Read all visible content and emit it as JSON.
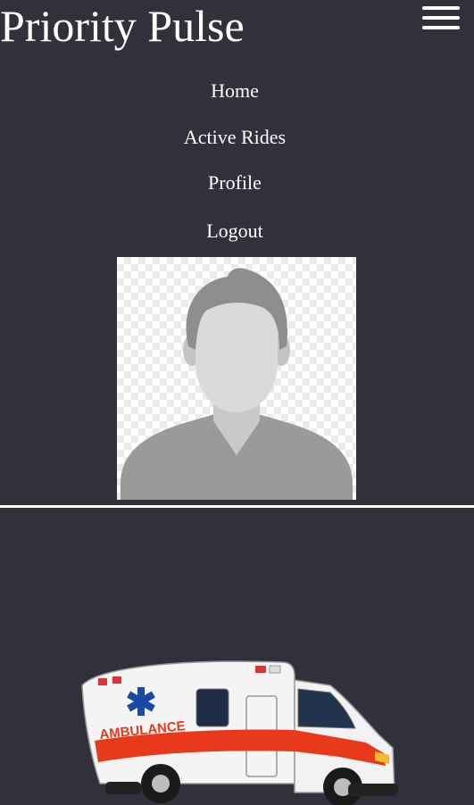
{
  "header": {
    "app_title": "Priority Pulse",
    "menu_icon": "hamburger-menu-icon"
  },
  "nav": {
    "items": [
      {
        "label": "Home"
      },
      {
        "label": "Active Rides"
      },
      {
        "label": "Profile"
      },
      {
        "label": "Logout"
      }
    ]
  },
  "profile": {
    "avatar_icon": "user-placeholder-avatar"
  },
  "hero": {
    "vehicle_label": "AMBULANCE",
    "image_icon": "ambulance-illustration"
  },
  "colors": {
    "background": "#31313c",
    "text": "#ffffff",
    "ambulance_stripe": "#e8391c",
    "star_of_life": "#1a4aa0"
  }
}
